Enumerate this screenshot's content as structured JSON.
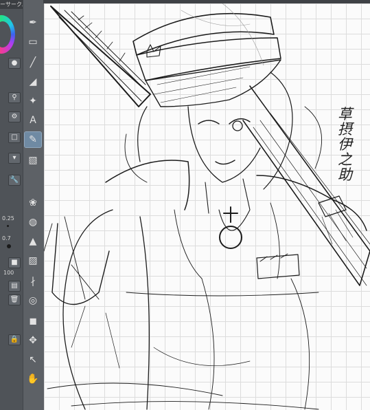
{
  "app": {
    "panel_title": "ーサークル"
  },
  "colors": {
    "canvas_bg": "#fbfbfb",
    "grid": "#dcdcdc",
    "main_color": "#0b0b0b",
    "sub_color": "#ffffff",
    "panel": "#4f5358",
    "tool_active": "#6f8aa3"
  },
  "brush": {
    "size_a": "0.25",
    "size_b": "0.7",
    "opacity": "100"
  },
  "tools": [
    {
      "icon": "pen-icon",
      "glyph": "✒"
    },
    {
      "icon": "rect-selection-icon",
      "glyph": "▭"
    },
    {
      "icon": "line-icon",
      "glyph": "╱"
    },
    {
      "icon": "fill-bucket-icon",
      "glyph": "◢"
    },
    {
      "icon": "magic-wand-icon",
      "glyph": "✦"
    },
    {
      "icon": "text-icon",
      "glyph": "A"
    },
    {
      "icon": "pencil-icon",
      "glyph": "✎"
    },
    {
      "icon": "eraser-icon",
      "glyph": "▧"
    },
    {
      "icon": "blend-icon",
      "glyph": "❀"
    },
    {
      "icon": "airbrush-icon",
      "glyph": "◍"
    },
    {
      "icon": "water-drop-icon",
      "glyph": "▲"
    },
    {
      "icon": "gradient-icon",
      "glyph": "▨"
    },
    {
      "icon": "ruler-icon",
      "glyph": "∤"
    },
    {
      "icon": "zoom-icon",
      "glyph": "◎"
    },
    {
      "icon": "speech-balloon-icon",
      "glyph": "◼"
    },
    {
      "icon": "move-icon",
      "glyph": "✥"
    },
    {
      "icon": "frame-cut-icon",
      "glyph": "↖"
    },
    {
      "icon": "hand-icon",
      "glyph": "✋"
    }
  ],
  "active_tool_index": 6,
  "signature": [
    "草",
    "摂",
    "伊",
    "之",
    "助"
  ]
}
